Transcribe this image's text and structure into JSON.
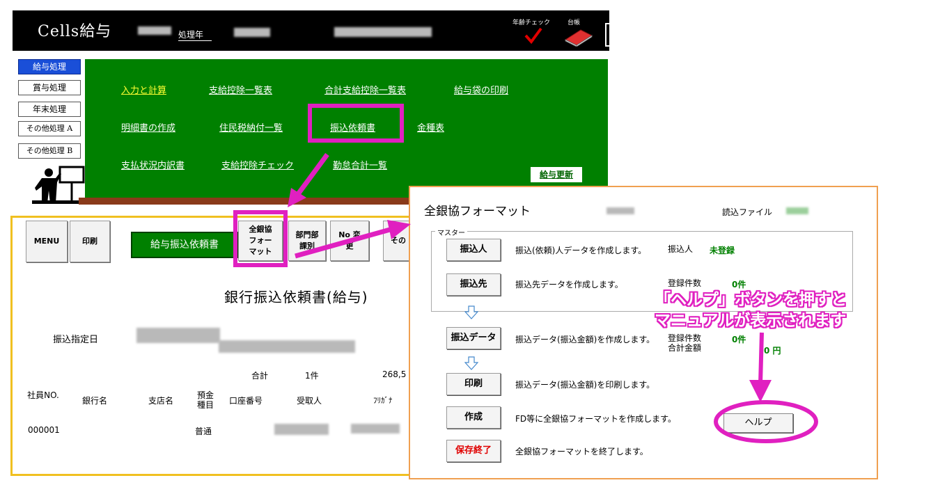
{
  "top_window": {
    "app_title": "Cells給与",
    "year_label": "処理年",
    "age_check_label": "年齢チェック",
    "ledger_label": "台帳",
    "side_menu": [
      {
        "label": "給与処理",
        "active": true
      },
      {
        "label": "賞与処理",
        "active": false
      },
      {
        "label": "年末処理",
        "active": false
      },
      {
        "label": "その他処理 A",
        "active": false
      },
      {
        "label": "その他処理 B",
        "active": false
      }
    ],
    "menu": {
      "input_calc": "入力と計算",
      "payment_deduction_list": "支給控除一覧表",
      "total_payment_deduction_list": "合計支給控除一覧表",
      "pay_envelope_print": "給与袋の印刷",
      "statement_create": "明細書の作成",
      "resident_tax_list": "住民税納付一覧",
      "transfer_request": "振込依頼書",
      "denomination_table": "金種表",
      "payment_status_detail": "支払状況内訳書",
      "payment_deduction_check": "支給控除チェック",
      "attendance_total_list": "勤怠合計一覧",
      "salary_update": "給与更新"
    }
  },
  "transfer_window": {
    "toolbar": {
      "menu": "MENU",
      "print": "印刷",
      "title_button": "給与振込依頼書",
      "zengin_format": "全銀協フォーマット",
      "dept": "部門部課別",
      "no_change": "No 変更",
      "other": "その"
    },
    "doc_title": "銀行振込依頼書(給与)",
    "designated_date_label": "振込指定日",
    "total_label": "合計",
    "total_count": "1件",
    "total_amount": "268,5",
    "columns": [
      "社員NO.",
      "銀行名",
      "支店名",
      "預金種目",
      "口座番号",
      "受取人",
      "ﾌﾘｶﾞﾅ"
    ],
    "row": {
      "employee_no": "000001",
      "account_type": "普通"
    }
  },
  "dialog": {
    "title": "全銀協フォーマット",
    "read_file_label": "読込ファイル",
    "master_legend": "マスター",
    "rows": [
      {
        "button": "振込人",
        "desc": "振込(依頼)人データを作成します。",
        "label": "振込人",
        "value": "未登録"
      },
      {
        "button": "振込先",
        "desc": "振込先データを作成します。",
        "label": "登録件数",
        "value": "0件"
      },
      {
        "button": "振込データ",
        "desc": "振込データ(振込金額)を作成します。",
        "label": "登録件数",
        "label2": "合計金額",
        "value": "0件",
        "value2": "0 円"
      },
      {
        "button": "印刷",
        "desc": "振込データ(振込金額)を印刷します。"
      },
      {
        "button": "作成",
        "desc": "FD等に全銀協フォーマットを作成します。"
      },
      {
        "button": "保存終了",
        "desc": "全銀協フォーマットを終了します。"
      }
    ],
    "help_button": "ヘルプ"
  },
  "callout": {
    "line1": "「ヘルプ」ボタンを押すと",
    "line2": "マニュアルが表示されます"
  },
  "colors": {
    "annotation": "#e020c0",
    "menu_green": "#008000",
    "active_blue": "#1a4fd8",
    "yellow_border": "#f0c020",
    "orange_border": "#f0a050"
  }
}
